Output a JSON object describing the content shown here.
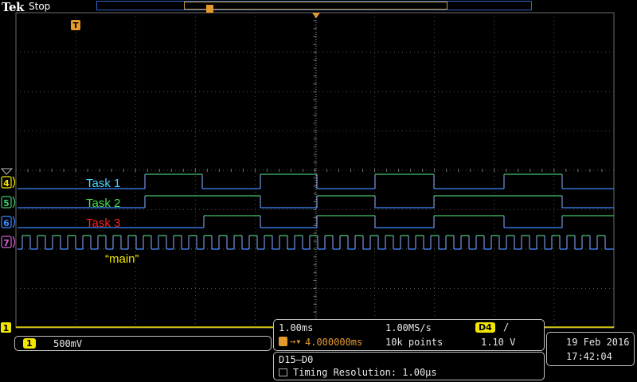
{
  "header": {
    "brand": "Tek",
    "status": "Stop"
  },
  "channels": [
    {
      "num": "4",
      "color": "#f2e600",
      "label": "Task 1",
      "label_color": "#46d7ff"
    },
    {
      "num": "5",
      "color": "#43c46a",
      "label": "Task 2",
      "label_color": "#43e04a"
    },
    {
      "num": "6",
      "color": "#3e89ff",
      "label": "Task 3",
      "label_color": "#ff1f1f"
    },
    {
      "num": "7",
      "color": "#d15fd1",
      "label": "“main”",
      "label_color": "#f2e600"
    }
  ],
  "ground_marker": "1",
  "trigger_marker": "T",
  "ch1_panel": {
    "channel": "1",
    "scale": "500mV"
  },
  "timebase": {
    "time_div": "1.00ms",
    "sample_rate": "1.00MS/s",
    "trigger_channel": "D4",
    "trigger_slope": "/",
    "trigger_pos": "4.000000ms",
    "record_length": "10k points",
    "trigger_level": "1.10 V"
  },
  "digital": {
    "range": "D15–D0",
    "resolution": "Timing Resolution: 1.00μs"
  },
  "datetime": {
    "date": "19 Feb  2016",
    "time": "17:42:04"
  }
}
